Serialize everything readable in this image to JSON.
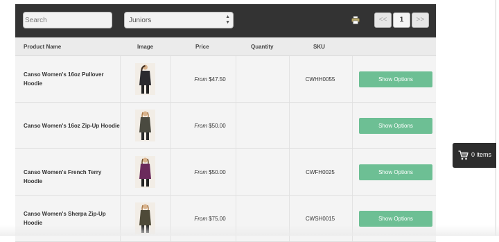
{
  "toolbar": {
    "search_placeholder": "Search",
    "category": "Juniors",
    "pager": {
      "prev": "<<",
      "page": "1",
      "next": ">>"
    }
  },
  "columns": [
    "Product Name",
    "Image",
    "Price",
    "Quantity",
    "SKU"
  ],
  "rows": [
    {
      "name": "Canso Women's 16oz Pullover Hoodie",
      "price_prefix": "From",
      "price": "$47.50",
      "sku": "CWHH0055",
      "button": "Show Options",
      "jacket_color": "#2a2a2e"
    },
    {
      "name": "Canso Women's 16oz Zip-Up Hoodie",
      "price_prefix": "From",
      "price": "$50.00",
      "sku": "",
      "button": "Show Options",
      "jacket_color": "#4a4a40"
    },
    {
      "name": "Canso Women's French Terry Hoodie",
      "price_prefix": "From",
      "price": "$50.00",
      "sku": "CWFH0025",
      "button": "Show Options",
      "jacket_color": "#6b2a5c"
    },
    {
      "name": "Canso Women's Sherpa Zip-Up Hoodie",
      "price_prefix": "From",
      "price": "$75.00",
      "sku": "CWSH0015",
      "button": "Show Options",
      "jacket_color": "#4e4a38"
    }
  ],
  "cart": {
    "label": "0 items"
  }
}
